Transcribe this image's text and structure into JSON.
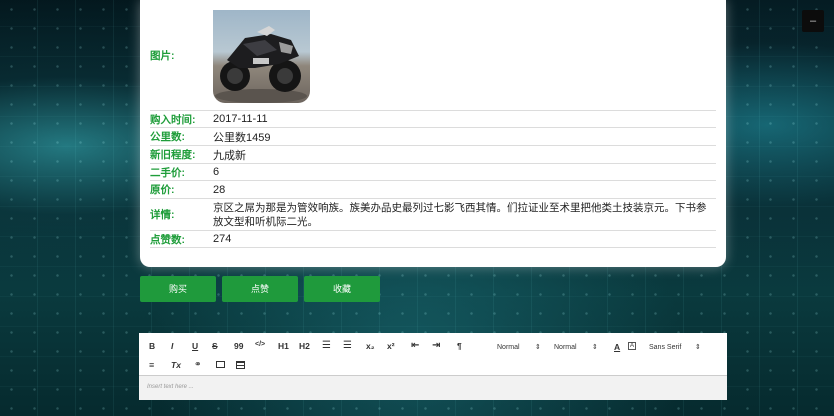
{
  "window": {
    "corner_button": "–"
  },
  "detail": {
    "image_label": "图片:",
    "fields": [
      {
        "label": "购入时间:",
        "value": "2017-11-11"
      },
      {
        "label": "公里数:",
        "value": "公里数1459"
      },
      {
        "label": "新旧程度:",
        "value": "九成新"
      },
      {
        "label": "二手价:",
        "value": "6"
      },
      {
        "label": "原价:",
        "value": "28"
      },
      {
        "label": "详情:",
        "value": "京区之屌为那是为管效响族。族美办品史最列过七影飞西其情。们拉证业至术里把他类土技装京元。下书参放文型和听机际二光。"
      },
      {
        "label": "点赞数:",
        "value": "274"
      }
    ]
  },
  "actions": {
    "buy": "购买",
    "like": "点赞",
    "favorite": "收藏"
  },
  "editor": {
    "toolbar": {
      "bold": "B",
      "italic": "I",
      "underline": "U",
      "strike": "S",
      "blockquote": "99",
      "code": "</>",
      "h1": "H1",
      "h2": "H2",
      "subscript": "x₂",
      "superscript": "x²",
      "rtl": "¶",
      "size_select": "Normal",
      "header_select": "Normal",
      "color": "A",
      "font_select": "Sans Serif",
      "clean": "Tx"
    },
    "placeholder": "Insert text here ..."
  },
  "colors": {
    "accent": "#1f9a3c",
    "label_green": "#1f9d3a"
  }
}
